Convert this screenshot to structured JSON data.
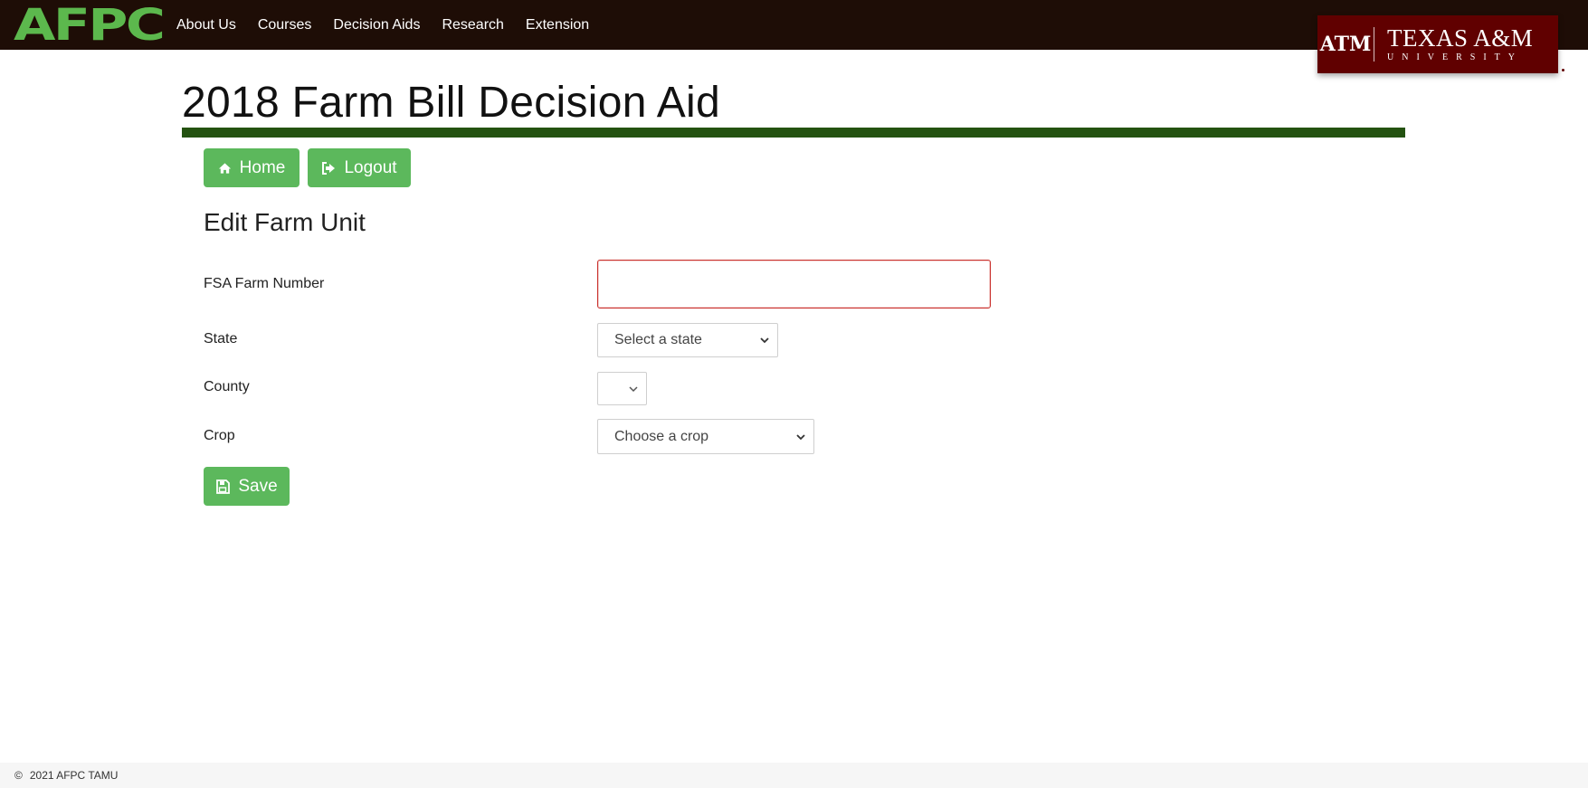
{
  "header": {
    "logo_text": "AFPC",
    "nav": [
      {
        "label": "About Us"
      },
      {
        "label": "Courses"
      },
      {
        "label": "Decision Aids"
      },
      {
        "label": "Research"
      },
      {
        "label": "Extension"
      }
    ],
    "university_logo": {
      "mark": "ATM",
      "line1": "TEXAS A&M",
      "line2": "UNIVERSITY"
    }
  },
  "page": {
    "title": "2018 Farm Bill Decision Aid",
    "buttons": {
      "home": {
        "label": "Home",
        "icon": "home-icon"
      },
      "logout": {
        "label": "Logout",
        "icon": "sign-out-icon"
      }
    },
    "section_title": "Edit Farm Unit"
  },
  "form": {
    "fsa_farm_number": {
      "label": "FSA Farm Number",
      "value": "",
      "state": "invalid"
    },
    "state": {
      "label": "State",
      "selected": "Select a state"
    },
    "county": {
      "label": "County",
      "selected": ""
    },
    "crop": {
      "label": "Crop",
      "selected": "Choose a crop"
    },
    "save": {
      "label": "Save",
      "icon": "floppy-disk-icon"
    }
  },
  "footer": {
    "copyright_symbol": "©",
    "text": "2021 AFPC TAMU"
  },
  "colors": {
    "header_bg": "#1e0d06",
    "brand_green": "#5cb84d",
    "rule_green": "#245211",
    "button_green": "#5cb85c",
    "tamu_maroon": "#600000",
    "error_red": "#c9302c"
  }
}
